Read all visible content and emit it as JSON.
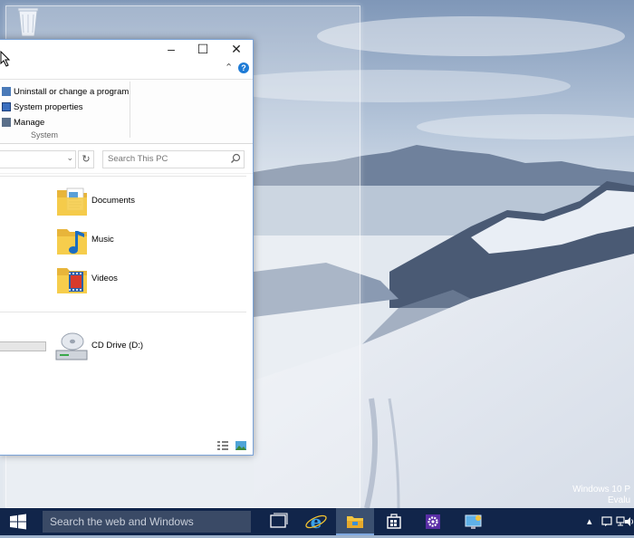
{
  "desktop": {
    "watermark_line1": "Windows 10 P",
    "watermark_line2": "Evalu"
  },
  "window": {
    "ribbon": {
      "items": [
        {
          "label": "Uninstall or change a program",
          "icon": "uninstall-icon"
        },
        {
          "label": "System properties",
          "icon": "system-properties-icon"
        },
        {
          "label": "Manage",
          "icon": "manage-icon"
        }
      ],
      "group_label": "System"
    },
    "search_placeholder": "Search This PC",
    "folders": [
      "Documents",
      "Music",
      "Videos"
    ],
    "drive": {
      "label": "CD Drive (D:)"
    }
  },
  "taskbar": {
    "search_placeholder": "Search the web and Windows",
    "bg_color": "#11254a"
  }
}
